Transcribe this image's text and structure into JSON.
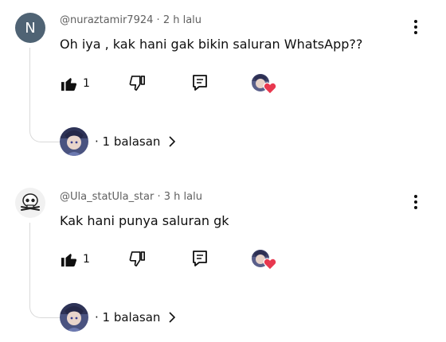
{
  "comments": [
    {
      "avatar_letter": "N",
      "username": "@nuraztamir7924",
      "separator": "·",
      "time": "2 h lalu",
      "text": "Oh iya , kak hani gak bikin saluran WhatsApp??",
      "likes": "1",
      "replies_label": "· 1 balasan"
    },
    {
      "avatar_letter": "",
      "username": "@Ula_statUla_star",
      "separator": "·",
      "time": "3 h lalu",
      "text": "Kak hani punya saluran gk",
      "likes": "1",
      "replies_label": "· 1 balasan"
    }
  ],
  "icons": {
    "like": "thumbs-up-icon",
    "dislike": "thumbs-down-icon",
    "reply": "comment-reply-icon",
    "creator_heart": "creator-heart-icon",
    "more": "more-vertical-icon",
    "chevron": "chevron-right-icon"
  },
  "colors": {
    "heart": "#e8384f",
    "letter_avatar": "#4f6374"
  }
}
